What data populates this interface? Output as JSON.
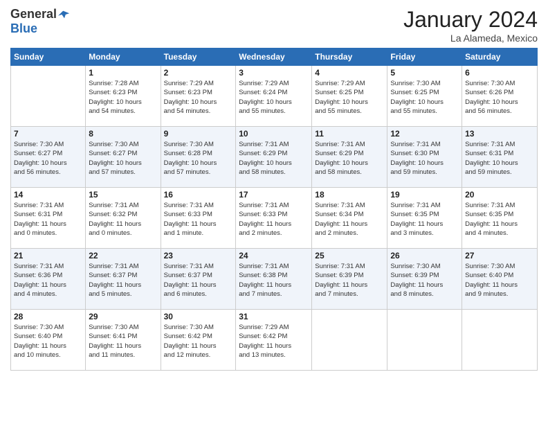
{
  "logo": {
    "general": "General",
    "blue": "Blue"
  },
  "title": {
    "month": "January 2024",
    "location": "La Alameda, Mexico"
  },
  "headers": [
    "Sunday",
    "Monday",
    "Tuesday",
    "Wednesday",
    "Thursday",
    "Friday",
    "Saturday"
  ],
  "weeks": [
    [
      {
        "day": "",
        "info": ""
      },
      {
        "day": "1",
        "info": "Sunrise: 7:28 AM\nSunset: 6:23 PM\nDaylight: 10 hours\nand 54 minutes."
      },
      {
        "day": "2",
        "info": "Sunrise: 7:29 AM\nSunset: 6:23 PM\nDaylight: 10 hours\nand 54 minutes."
      },
      {
        "day": "3",
        "info": "Sunrise: 7:29 AM\nSunset: 6:24 PM\nDaylight: 10 hours\nand 55 minutes."
      },
      {
        "day": "4",
        "info": "Sunrise: 7:29 AM\nSunset: 6:25 PM\nDaylight: 10 hours\nand 55 minutes."
      },
      {
        "day": "5",
        "info": "Sunrise: 7:30 AM\nSunset: 6:25 PM\nDaylight: 10 hours\nand 55 minutes."
      },
      {
        "day": "6",
        "info": "Sunrise: 7:30 AM\nSunset: 6:26 PM\nDaylight: 10 hours\nand 56 minutes."
      }
    ],
    [
      {
        "day": "7",
        "info": "Sunrise: 7:30 AM\nSunset: 6:27 PM\nDaylight: 10 hours\nand 56 minutes."
      },
      {
        "day": "8",
        "info": "Sunrise: 7:30 AM\nSunset: 6:27 PM\nDaylight: 10 hours\nand 57 minutes."
      },
      {
        "day": "9",
        "info": "Sunrise: 7:30 AM\nSunset: 6:28 PM\nDaylight: 10 hours\nand 57 minutes."
      },
      {
        "day": "10",
        "info": "Sunrise: 7:31 AM\nSunset: 6:29 PM\nDaylight: 10 hours\nand 58 minutes."
      },
      {
        "day": "11",
        "info": "Sunrise: 7:31 AM\nSunset: 6:29 PM\nDaylight: 10 hours\nand 58 minutes."
      },
      {
        "day": "12",
        "info": "Sunrise: 7:31 AM\nSunset: 6:30 PM\nDaylight: 10 hours\nand 59 minutes."
      },
      {
        "day": "13",
        "info": "Sunrise: 7:31 AM\nSunset: 6:31 PM\nDaylight: 10 hours\nand 59 minutes."
      }
    ],
    [
      {
        "day": "14",
        "info": "Sunrise: 7:31 AM\nSunset: 6:31 PM\nDaylight: 11 hours\nand 0 minutes."
      },
      {
        "day": "15",
        "info": "Sunrise: 7:31 AM\nSunset: 6:32 PM\nDaylight: 11 hours\nand 0 minutes."
      },
      {
        "day": "16",
        "info": "Sunrise: 7:31 AM\nSunset: 6:33 PM\nDaylight: 11 hours\nand 1 minute."
      },
      {
        "day": "17",
        "info": "Sunrise: 7:31 AM\nSunset: 6:33 PM\nDaylight: 11 hours\nand 2 minutes."
      },
      {
        "day": "18",
        "info": "Sunrise: 7:31 AM\nSunset: 6:34 PM\nDaylight: 11 hours\nand 2 minutes."
      },
      {
        "day": "19",
        "info": "Sunrise: 7:31 AM\nSunset: 6:35 PM\nDaylight: 11 hours\nand 3 minutes."
      },
      {
        "day": "20",
        "info": "Sunrise: 7:31 AM\nSunset: 6:35 PM\nDaylight: 11 hours\nand 4 minutes."
      }
    ],
    [
      {
        "day": "21",
        "info": "Sunrise: 7:31 AM\nSunset: 6:36 PM\nDaylight: 11 hours\nand 4 minutes."
      },
      {
        "day": "22",
        "info": "Sunrise: 7:31 AM\nSunset: 6:37 PM\nDaylight: 11 hours\nand 5 minutes."
      },
      {
        "day": "23",
        "info": "Sunrise: 7:31 AM\nSunset: 6:37 PM\nDaylight: 11 hours\nand 6 minutes."
      },
      {
        "day": "24",
        "info": "Sunrise: 7:31 AM\nSunset: 6:38 PM\nDaylight: 11 hours\nand 7 minutes."
      },
      {
        "day": "25",
        "info": "Sunrise: 7:31 AM\nSunset: 6:39 PM\nDaylight: 11 hours\nand 7 minutes."
      },
      {
        "day": "26",
        "info": "Sunrise: 7:30 AM\nSunset: 6:39 PM\nDaylight: 11 hours\nand 8 minutes."
      },
      {
        "day": "27",
        "info": "Sunrise: 7:30 AM\nSunset: 6:40 PM\nDaylight: 11 hours\nand 9 minutes."
      }
    ],
    [
      {
        "day": "28",
        "info": "Sunrise: 7:30 AM\nSunset: 6:40 PM\nDaylight: 11 hours\nand 10 minutes."
      },
      {
        "day": "29",
        "info": "Sunrise: 7:30 AM\nSunset: 6:41 PM\nDaylight: 11 hours\nand 11 minutes."
      },
      {
        "day": "30",
        "info": "Sunrise: 7:30 AM\nSunset: 6:42 PM\nDaylight: 11 hours\nand 12 minutes."
      },
      {
        "day": "31",
        "info": "Sunrise: 7:29 AM\nSunset: 6:42 PM\nDaylight: 11 hours\nand 13 minutes."
      },
      {
        "day": "",
        "info": ""
      },
      {
        "day": "",
        "info": ""
      },
      {
        "day": "",
        "info": ""
      }
    ]
  ]
}
